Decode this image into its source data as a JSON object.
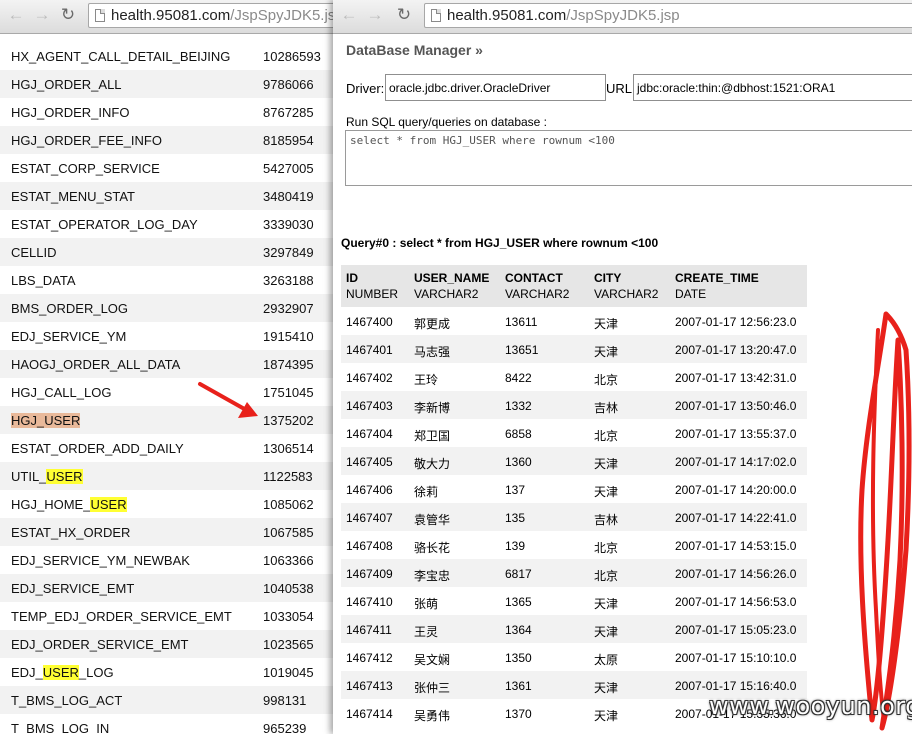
{
  "left_browser": {
    "url_host": "health.95081.com",
    "url_path": "/JspSpyJDK5.js",
    "tables": [
      {
        "pre": "HX_AGENT_CALL_DETAIL_BEIJING",
        "hl": "",
        "post": "",
        "count": "10286593"
      },
      {
        "pre": "HGJ_ORDER_ALL",
        "hl": "",
        "post": "",
        "count": "9786066"
      },
      {
        "pre": "HGJ_ORDER_INFO",
        "hl": "",
        "post": "",
        "count": "8767285"
      },
      {
        "pre": "HGJ_ORDER_FEE_INFO",
        "hl": "",
        "post": "",
        "count": "8185954"
      },
      {
        "pre": "ESTAT_CORP_SERVICE",
        "hl": "",
        "post": "",
        "count": "5427005"
      },
      {
        "pre": "ESTAT_MENU_STAT",
        "hl": "",
        "post": "",
        "count": "3480419"
      },
      {
        "pre": "ESTAT_OPERATOR_LOG_DAY",
        "hl": "",
        "post": "",
        "count": "3339030"
      },
      {
        "pre": "CELLID",
        "hl": "",
        "post": "",
        "count": "3297849"
      },
      {
        "pre": "LBS_DATA",
        "hl": "",
        "post": "",
        "count": "3263188"
      },
      {
        "pre": "BMS_ORDER_LOG",
        "hl": "",
        "post": "",
        "count": "2932907"
      },
      {
        "pre": "EDJ_SERVICE_YM",
        "hl": "",
        "post": "",
        "count": "1915410"
      },
      {
        "pre": "HAOGJ_ORDER_ALL_DATA",
        "hl": "",
        "post": "",
        "count": "1874395"
      },
      {
        "pre": "HGJ_CALL_LOG",
        "hl": "",
        "post": "",
        "count": "1751045"
      },
      {
        "pre": "HGJ_",
        "hl": "USER",
        "post": "",
        "count": "1375202",
        "selected": true
      },
      {
        "pre": "ESTAT_ORDER_ADD_DAILY",
        "hl": "",
        "post": "",
        "count": "1306514"
      },
      {
        "pre": "UTIL_",
        "hl": "USER",
        "post": "",
        "count": "1122583"
      },
      {
        "pre": "HGJ_HOME_",
        "hl": "USER",
        "post": "",
        "count": "1085062"
      },
      {
        "pre": "ESTAT_HX_ORDER",
        "hl": "",
        "post": "",
        "count": "1067585"
      },
      {
        "pre": "EDJ_SERVICE_YM_NEWBAK",
        "hl": "",
        "post": "",
        "count": "1063366"
      },
      {
        "pre": "EDJ_SERVICE_EMT",
        "hl": "",
        "post": "",
        "count": "1040538"
      },
      {
        "pre": "TEMP_EDJ_ORDER_SERVICE_EMT",
        "hl": "",
        "post": "",
        "count": "1033054"
      },
      {
        "pre": "EDJ_ORDER_SERVICE_EMT",
        "hl": "",
        "post": "",
        "count": "1023565"
      },
      {
        "pre": "EDJ_",
        "hl": "USER",
        "post": "_LOG",
        "count": "1019045"
      },
      {
        "pre": "T_BMS_LOG_ACT",
        "hl": "",
        "post": "",
        "count": "998131"
      },
      {
        "pre": "T_BMS_LOG_IN",
        "hl": "",
        "post": "",
        "count": "965239"
      }
    ]
  },
  "right_browser": {
    "url_host": "health.95081.com",
    "url_path": "/JspSpyJDK5.jsp",
    "title": "DataBase Manager »",
    "driver_label": "Driver:",
    "driver_value": "oracle.jdbc.driver.OracleDriver",
    "url_label": "URL:",
    "url_value": "jdbc:oracle:thin:@dbhost:1521:ORA1",
    "sql_label": "Run SQL query/queries on database :",
    "sql_text": "select * from HGJ_USER where rownum <100",
    "query_title": "Query#0 : select * from HGJ_USER where rownum <100",
    "columns": [
      {
        "name": "ID",
        "type": "NUMBER"
      },
      {
        "name": "USER_NAME",
        "type": "VARCHAR2"
      },
      {
        "name": "CONTACT",
        "type": "VARCHAR2"
      },
      {
        "name": "CITY",
        "type": "VARCHAR2"
      },
      {
        "name": "CREATE_TIME",
        "type": "DATE"
      }
    ],
    "rows": [
      [
        "1467400",
        "郭更成",
        "13611",
        "天津",
        "2007-01-17 12:56:23.0"
      ],
      [
        "1467401",
        "马志强",
        "13651",
        "天津",
        "2007-01-17 13:20:47.0"
      ],
      [
        "1467402",
        "王玲",
        "8422",
        "北京",
        "2007-01-17 13:42:31.0"
      ],
      [
        "1467403",
        "李新博",
        "1332",
        "吉林",
        "2007-01-17 13:50:46.0"
      ],
      [
        "1467404",
        "郑卫国",
        "6858",
        "北京",
        "2007-01-17 13:55:37.0"
      ],
      [
        "1467405",
        "敬大力",
        "1360",
        "天津",
        "2007-01-17 14:17:02.0"
      ],
      [
        "1467406",
        "徐莉",
        "137",
        "天津",
        "2007-01-17 14:20:00.0"
      ],
      [
        "1467407",
        "袁管华",
        "135",
        "吉林",
        "2007-01-17 14:22:41.0"
      ],
      [
        "1467408",
        "骆长花",
        "139",
        "北京",
        "2007-01-17 14:53:15.0"
      ],
      [
        "1467409",
        "李宝忠",
        "6817",
        "北京",
        "2007-01-17 14:56:26.0"
      ],
      [
        "1467410",
        "张萌",
        "1365",
        "天津",
        "2007-01-17 14:56:53.0"
      ],
      [
        "1467411",
        "王灵",
        "1364",
        "天津",
        "2007-01-17 15:05:23.0"
      ],
      [
        "1467412",
        "吴文娴",
        "1350",
        "太原",
        "2007-01-17 15:10:10.0"
      ],
      [
        "1467413",
        "张仲三",
        "1361",
        "天津",
        "2007-01-17 15:16:40.0"
      ],
      [
        "1467414",
        "吴勇伟",
        "1370",
        "天津",
        "2007-01-17 15:35:36.0"
      ]
    ]
  },
  "watermark": "www.wooyun.org",
  "colors": {
    "highlight": "#ffff33",
    "selection": "#e9b99a",
    "annotation": "#e8211b"
  }
}
